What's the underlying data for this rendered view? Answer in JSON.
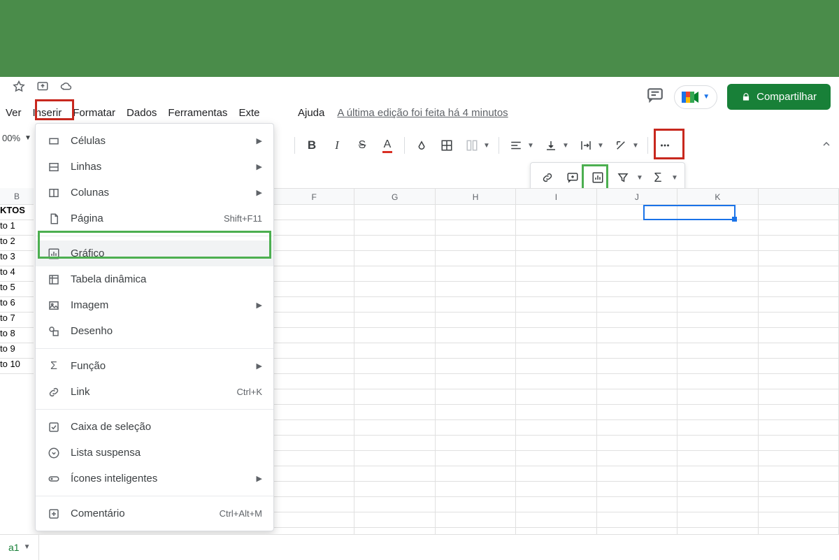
{
  "banner": {},
  "titlebar": {},
  "menubar": {
    "items": [
      "Ver",
      "Inserir",
      "Formatar",
      "Dados",
      "Ferramentas",
      "Exte"
    ],
    "help": "Ajuda",
    "last_edit": "A última edição foi feita há 4 minutos"
  },
  "share_button": "Compartilhar",
  "zoom": "00%",
  "toolbar": {},
  "columns": {
    "b": "B",
    "f": "F",
    "g": "G",
    "h": "H",
    "i": "I",
    "j": "J",
    "k": "K"
  },
  "leftdata": {
    "header": "KTOS",
    "rows": [
      "to 1",
      "to 2",
      "to 3",
      "to 4",
      "to 5",
      "to 6",
      "to 7",
      "to 8",
      "to 9",
      "to 10"
    ]
  },
  "dropdown": {
    "items": [
      {
        "icon": "cells",
        "label": "Células",
        "sub": true
      },
      {
        "icon": "rows",
        "label": "Linhas",
        "sub": true
      },
      {
        "icon": "cols",
        "label": "Colunas",
        "sub": true
      },
      {
        "icon": "page",
        "label": "Página",
        "shortcut": "Shift+F11"
      },
      {
        "sep": true
      },
      {
        "icon": "chart",
        "label": "Gráfico",
        "highlight": true
      },
      {
        "icon": "pivot",
        "label": "Tabela dinâmica"
      },
      {
        "icon": "image",
        "label": "Imagem",
        "sub": true
      },
      {
        "icon": "drawing",
        "label": "Desenho"
      },
      {
        "sep": true
      },
      {
        "icon": "sigma",
        "label": "Função",
        "sub": true
      },
      {
        "icon": "link",
        "label": "Link",
        "shortcut": "Ctrl+K"
      },
      {
        "sep": true
      },
      {
        "icon": "checkbox",
        "label": "Caixa de seleção"
      },
      {
        "icon": "dropdown",
        "label": "Lista suspensa"
      },
      {
        "icon": "smart",
        "label": "Ícones inteligentes",
        "sub": true
      },
      {
        "sep": true
      },
      {
        "icon": "comment",
        "label": "Comentário",
        "shortcut": "Ctrl+Alt+M"
      }
    ]
  },
  "sheet": {
    "name": "a1"
  }
}
